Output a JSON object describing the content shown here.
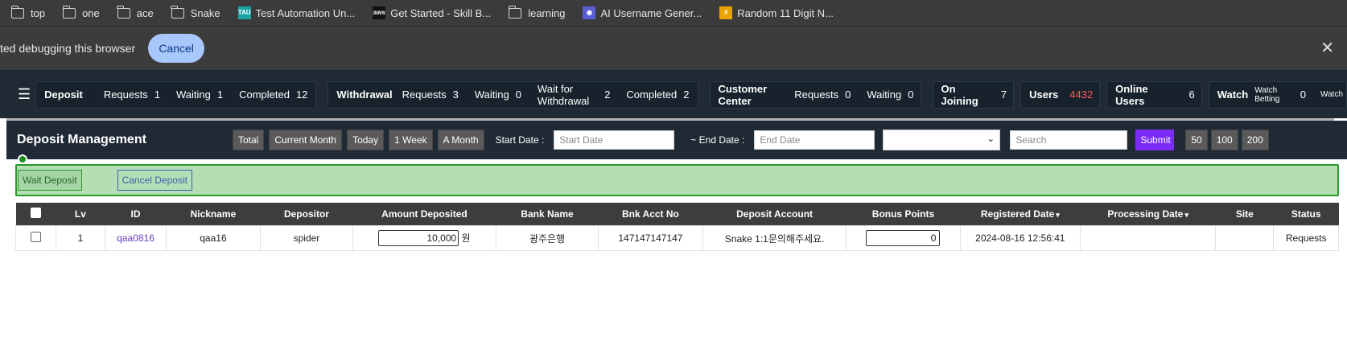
{
  "bookmarks": [
    {
      "label": "top",
      "icon": "folder-icon"
    },
    {
      "label": "one",
      "icon": "folder-icon"
    },
    {
      "label": "ace",
      "icon": "folder-icon"
    },
    {
      "label": "Snake",
      "icon": "folder-icon"
    },
    {
      "label": "Test Automation Un...",
      "icon": "tau-favicon",
      "fav_text": "TAU",
      "color": "#1aa3a3"
    },
    {
      "label": "Get Started - Skill B...",
      "icon": "aws-favicon",
      "fav_text": "aws",
      "color": "#111111"
    },
    {
      "label": "learning",
      "icon": "folder-icon"
    },
    {
      "label": "AI Username Gener...",
      "icon": "ai-favicon",
      "fav_text": "◉",
      "color": "#5b5bd6"
    },
    {
      "label": "Random 11 Digit N...",
      "icon": "hash-favicon",
      "fav_text": "#",
      "color": "#e8a400"
    }
  ],
  "debug_bar": {
    "message": "ted debugging this browser",
    "cancel_label": "Cancel",
    "close_glyph": "✕"
  },
  "topnav": {
    "menu_glyph": "☰",
    "deposit": {
      "title": "Deposit",
      "requests_label": "Requests",
      "requests": "1",
      "waiting_label": "Waiting",
      "waiting": "1",
      "completed_label": "Completed",
      "completed": "12"
    },
    "withdrawal": {
      "title": "Withdrawal",
      "requests_label": "Requests",
      "requests": "3",
      "waiting_label": "Waiting",
      "waiting": "0",
      "wait_label": "Wait for Withdrawal",
      "wait": "2",
      "completed_label": "Completed",
      "completed": "2"
    },
    "customer": {
      "title": "Customer Center",
      "requests_label": "Requests",
      "requests": "0",
      "waiting_label": "Waiting",
      "waiting": "0"
    },
    "joining": {
      "title": "On Joining",
      "count": "7"
    },
    "users": {
      "title": "Users",
      "count": "4432"
    },
    "online": {
      "title": "Online Users",
      "count": "6"
    },
    "watch": {
      "title": "Watch",
      "betting_label": "Watch Betting",
      "betting": "0",
      "more_label": "Watch"
    }
  },
  "panel": {
    "title": "Deposit Management",
    "filters": [
      "Total",
      "Current Month",
      "Today",
      "1 Week",
      "A Month"
    ],
    "start_label": "Start Date :",
    "start_placeholder": "Start Date",
    "end_label": "~ End Date :",
    "end_placeholder": "End Date",
    "select_value": "",
    "search_placeholder": "Search",
    "submit_label": "Submit",
    "page_sizes": [
      "50",
      "100",
      "200"
    ],
    "wait_deposit_label": "Wait Deposit",
    "cancel_deposit_label": "Cancel Deposit"
  },
  "table": {
    "headers": [
      "Lv",
      "ID",
      "Nickname",
      "Depositor",
      "Amount Deposited",
      "Bank Name",
      "Bnk Acct No",
      "Deposit Account",
      "Bonus Points",
      "Registered Date",
      "Processing Date",
      "Site",
      "Status"
    ],
    "sort_caret": "▾",
    "rows": [
      {
        "lv": "1",
        "id": "qaa0816",
        "nickname": "qaa16",
        "depositor": "spider",
        "amount": "10,000",
        "currency": "원",
        "bank": "광주은행",
        "acct": "147147147147",
        "account": "Snake 1:1문의해주세요.",
        "bonus": "0",
        "registered": "2024-08-16 12:56:41",
        "processing": "",
        "site": "",
        "status": "Requests"
      }
    ]
  }
}
